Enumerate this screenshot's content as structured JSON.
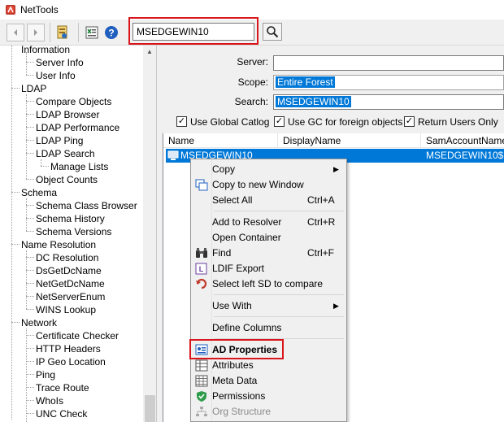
{
  "window": {
    "title": "NetTools"
  },
  "toolbar": {
    "search_value": "MSEDGEWIN10"
  },
  "tree": {
    "items": [
      {
        "label": "Information",
        "level": 0
      },
      {
        "label": "Server Info",
        "level": 1
      },
      {
        "label": "User Info",
        "level": 1
      },
      {
        "label": "LDAP",
        "level": 0
      },
      {
        "label": "Compare Objects",
        "level": 1
      },
      {
        "label": "LDAP Browser",
        "level": 1
      },
      {
        "label": "LDAP Performance",
        "level": 1
      },
      {
        "label": "LDAP Ping",
        "level": 1
      },
      {
        "label": "LDAP Search",
        "level": 1
      },
      {
        "label": "Manage Lists",
        "level": 2
      },
      {
        "label": "Object Counts",
        "level": 1
      },
      {
        "label": "Schema",
        "level": 0
      },
      {
        "label": "Schema Class Browser",
        "level": 1
      },
      {
        "label": "Schema History",
        "level": 1
      },
      {
        "label": "Schema Versions",
        "level": 1
      },
      {
        "label": "Name Resolution",
        "level": 0
      },
      {
        "label": "DC Resolution",
        "level": 1
      },
      {
        "label": "DsGetDcName",
        "level": 1
      },
      {
        "label": "NetGetDcName",
        "level": 1
      },
      {
        "label": "NetServerEnum",
        "level": 1
      },
      {
        "label": "WINS Lookup",
        "level": 1
      },
      {
        "label": "Network",
        "level": 0
      },
      {
        "label": "Certificate Checker",
        "level": 1
      },
      {
        "label": "HTTP Headers",
        "level": 1
      },
      {
        "label": "IP Geo Location",
        "level": 1
      },
      {
        "label": "Ping",
        "level": 1
      },
      {
        "label": "Trace Route",
        "level": 1
      },
      {
        "label": "WhoIs",
        "level": 1
      },
      {
        "label": "UNC Check",
        "level": 1
      }
    ]
  },
  "form": {
    "server_label": "Server:",
    "server_value": "",
    "scope_label": "Scope:",
    "scope_value": "Entire Forest",
    "search_label": "Search:",
    "search_value": "MSEDGEWIN10"
  },
  "options": {
    "use_global_catalog": "Use Global Catlog",
    "use_gc_foreign": "Use GC for foreign objects",
    "return_users_only": "Return Users Only"
  },
  "results": {
    "columns": [
      "Name",
      "DisplayName",
      "SamAccountName"
    ],
    "rows": [
      {
        "name": "MSEDGEWIN10",
        "display_name": "",
        "sam": "MSEDGEWIN10$"
      }
    ]
  },
  "context_menu": {
    "copy": "Copy",
    "copy_new_window": "Copy to new Window",
    "select_all": "Select All",
    "select_all_shortcut": "Ctrl+A",
    "add_to_resolver": "Add to Resolver",
    "add_to_resolver_shortcut": "Ctrl+R",
    "open_container": "Open Container",
    "find": "Find",
    "find_shortcut": "Ctrl+F",
    "ldif_export": "LDIF Export",
    "select_left_sd": "Select left SD to compare",
    "use_with": "Use With",
    "define_columns": "Define Columns",
    "ad_properties": "AD Properties",
    "attributes": "Attributes",
    "meta_data": "Meta Data",
    "permissions": "Permissions",
    "org_structure": "Org Structure"
  }
}
